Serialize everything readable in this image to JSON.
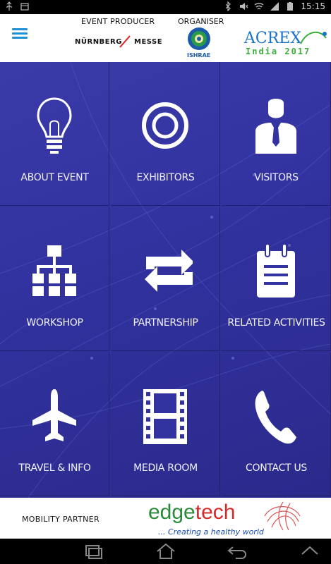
{
  "status_bar": {
    "time": "15:15"
  },
  "header": {
    "event_producer_label": "EVENT PRODUCER",
    "organiser_label": "ORGANISER",
    "nm_logo_left": "NÜRNBERG",
    "nm_logo_right": "MESSE",
    "ishrae_label": "ISHRAE",
    "acrex_title": "ACREX",
    "acrex_subtitle": "India 2017"
  },
  "grid": {
    "items": [
      {
        "label": "ABOUT EVENT",
        "icon": "lightbulb-icon"
      },
      {
        "label": "EXHIBITORS",
        "icon": "target-icon"
      },
      {
        "label": "VISITORS",
        "icon": "person-icon"
      },
      {
        "label": "WORKSHOP",
        "icon": "hierarchy-icon"
      },
      {
        "label": "PARTNERSHIP",
        "icon": "exchange-arrows-icon"
      },
      {
        "label": "RELATED ACTIVITIES",
        "icon": "notepad-icon"
      },
      {
        "label": "TRAVEL & INFO",
        "icon": "airplane-icon"
      },
      {
        "label": "MEDIA ROOM",
        "icon": "film-strip-icon"
      },
      {
        "label": "CONTACT US",
        "icon": "phone-icon"
      }
    ]
  },
  "footer": {
    "mobility_label": "MOBILITY PARTNER",
    "edgetech_title_a": "edge",
    "edgetech_title_b": "tech",
    "edgetech_tagline": "... Creating a healthy world"
  },
  "colors": {
    "accent_blue": "#1f8fd6",
    "grid_bg": "#3232a0",
    "edgetech_green": "#2a8a3a",
    "edgetech_red": "#d42a2a"
  }
}
